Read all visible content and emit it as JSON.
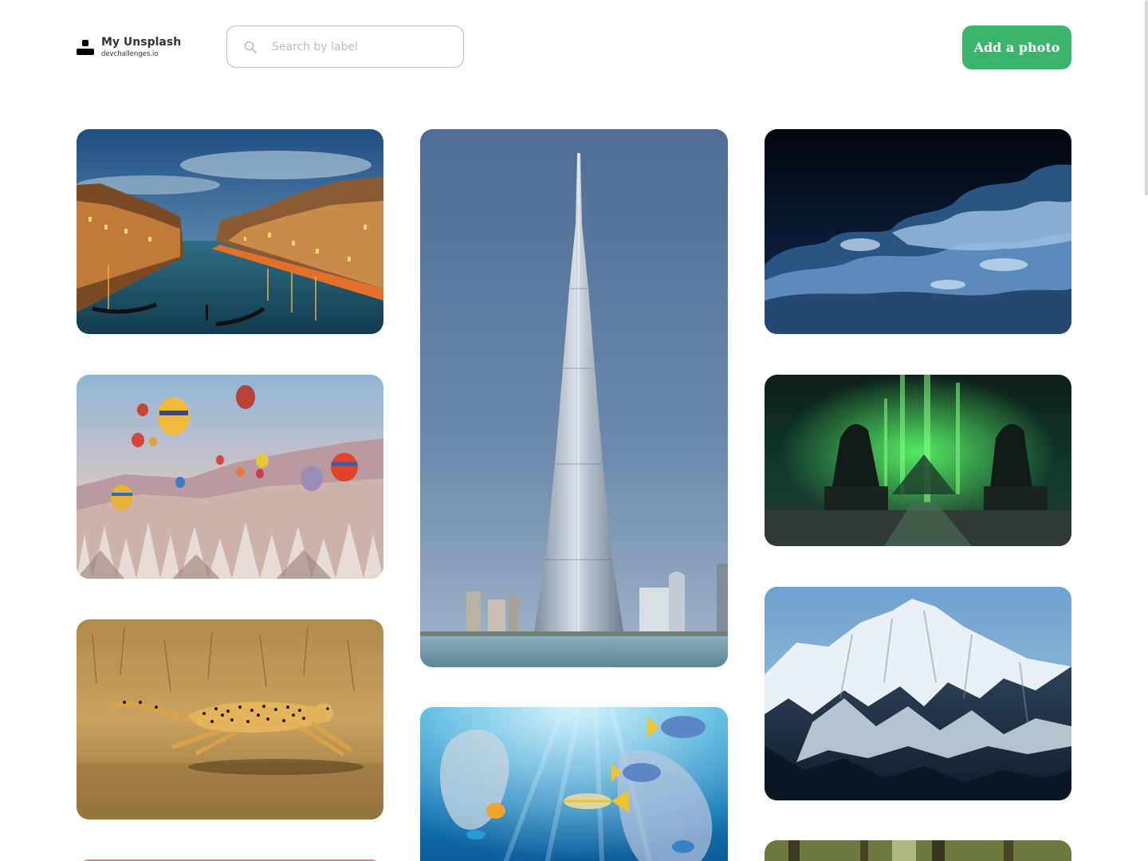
{
  "brand": {
    "title": "My Unsplash",
    "subtitle": "devchallenges.io"
  },
  "search": {
    "placeholder": "Search by label",
    "value": ""
  },
  "header": {
    "add_photo_label": "Add a photo"
  },
  "colors": {
    "accent": "#3db46d",
    "text": "#333333",
    "placeholder": "#bdbdbd",
    "border": "#bdbdbd"
  },
  "photos": [
    {
      "subject": "venice-canal-dusk"
    },
    {
      "subject": "hot-air-balloons-cappadocia"
    },
    {
      "subject": "running-cheetah"
    },
    {
      "subject": "burj-khalifa-tower"
    },
    {
      "subject": "underwater-fish-plastic-bags"
    },
    {
      "subject": "night-sky-clouds-moon"
    },
    {
      "subject": "green-glowing-ruins"
    },
    {
      "subject": "snowy-mountain-range"
    },
    {
      "subject": "pink-photo-partial"
    },
    {
      "subject": "forest-photo-partial"
    }
  ]
}
